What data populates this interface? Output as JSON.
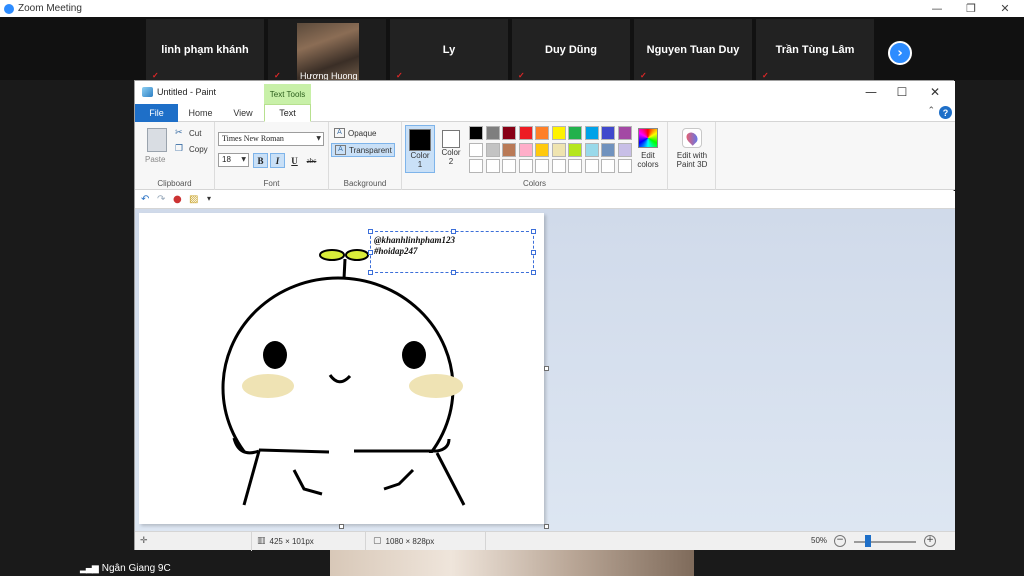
{
  "zoom": {
    "title": "Zoom Meeting",
    "participants": [
      {
        "name": "linh phạm khánh"
      },
      {
        "name": "Hương Huong"
      },
      {
        "name": "Ly"
      },
      {
        "name": "Duy Dũng"
      },
      {
        "name": "Nguyen Tuan Duy"
      },
      {
        "name": "Trần Tùng Lâm"
      }
    ],
    "bottom_name": "Ngân Giang 9C"
  },
  "paint": {
    "title": "Untitled - Paint",
    "context_tab": "Text Tools",
    "tabs": [
      "File",
      "Home",
      "View",
      "Text"
    ],
    "clipboard": {
      "paste": "Paste",
      "cut": "Cut",
      "copy": "Copy",
      "group": "Clipboard"
    },
    "font": {
      "family": "Times New Roman",
      "size": "18",
      "bold": "B",
      "italic": "I",
      "underline": "U",
      "strike": "abc",
      "group": "Font"
    },
    "background": {
      "opaque": "Opaque",
      "transparent": "Transparent",
      "group": "Background"
    },
    "colors": {
      "color1_label": "Color\n1",
      "color2_label": "Color\n2",
      "color1": "#000000",
      "color2": "#ffffff",
      "palette_row1": [
        "#000000",
        "#7f7f7f",
        "#880015",
        "#ed1c24",
        "#ff7f27",
        "#fff200",
        "#22b14c",
        "#00a2e8",
        "#3f48cc",
        "#a349a4"
      ],
      "palette_row2": [
        "#ffffff",
        "#c3c3c3",
        "#b97a57",
        "#ffaec9",
        "#ffc90e",
        "#efe4b0",
        "#b5e61d",
        "#99d9ea",
        "#7092be",
        "#c8bfe7"
      ],
      "edit_colors": "Edit colors",
      "group": "Colors"
    },
    "paint3d": "Edit with Paint 3D",
    "text_box": {
      "line1": "@khanhlinhpham123",
      "line2": "#hoidap247"
    },
    "status": {
      "selection_size": "425 × 101px",
      "canvas_size": "1080 × 828px",
      "zoom": "50%"
    }
  }
}
